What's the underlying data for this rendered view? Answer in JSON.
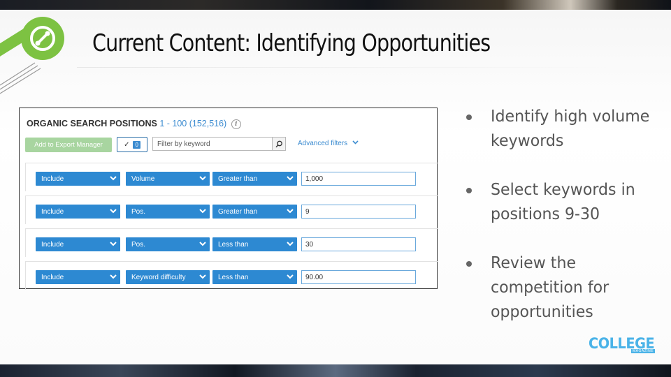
{
  "slide": {
    "title": "Current Content: Identifying Opportunities",
    "brand": "COLLEGE",
    "brand_sub": "MAGAZINE",
    "accent_color": "#7dc242",
    "brand_color": "#4ab3e8"
  },
  "panel": {
    "header": "ORGANIC SEARCH POSITIONS",
    "count": "1 - 100 (152,516)",
    "info_icon": "info-icon",
    "export_button": "Add to Export Manager",
    "toggle_count": "0",
    "keyword_placeholder": "Filter by keyword",
    "advanced_filters": "Advanced filters",
    "filter_color": "#2d89d2",
    "filters": [
      {
        "mode": "Include",
        "field": "Volume",
        "operator": "Greater than",
        "value": "1,000"
      },
      {
        "mode": "Include",
        "field": "Pos.",
        "operator": "Greater than",
        "value": "9"
      },
      {
        "mode": "Include",
        "field": "Pos.",
        "operator": "Less than",
        "value": "30"
      },
      {
        "mode": "Include",
        "field": "Keyword difficulty",
        "operator": "Less than",
        "value": "90.00"
      }
    ]
  },
  "bullets": [
    "Identify high volume keywords",
    "Select keywords in positions 9-30",
    "Review the competition for opportunities"
  ]
}
